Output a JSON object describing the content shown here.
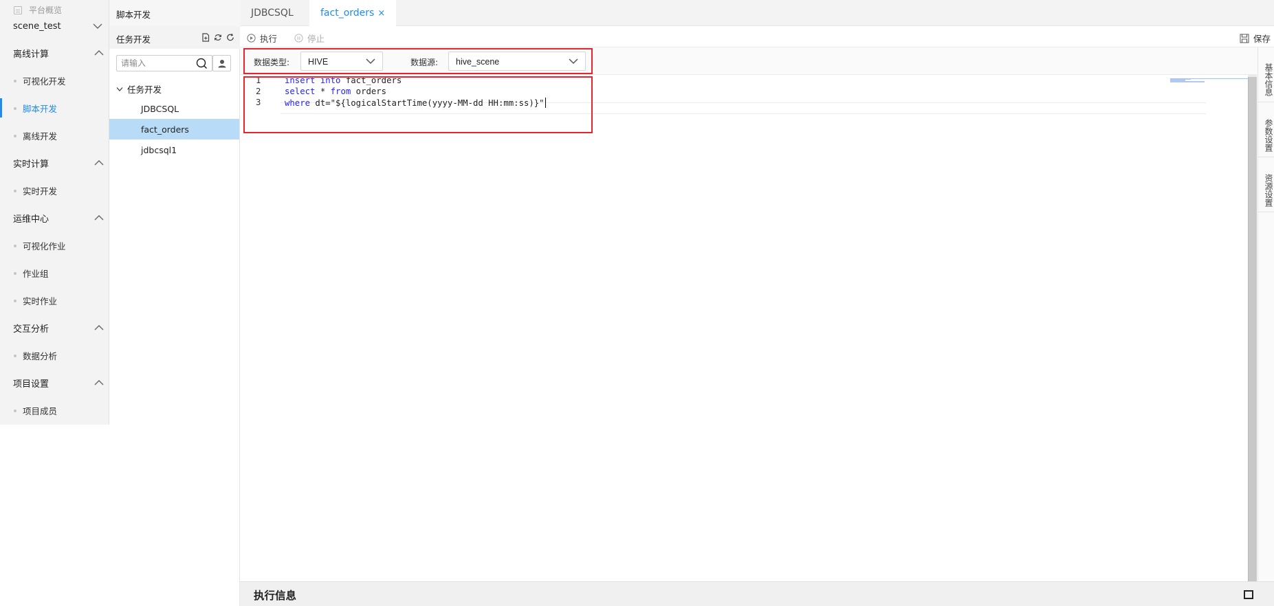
{
  "nav": {
    "overview": "平台概览",
    "project": "scene_test",
    "groups": [
      {
        "label": "离线计算",
        "items": [
          "可视化开发",
          "脚本开发",
          "离线开发"
        ]
      },
      {
        "label": "实时计算",
        "items": [
          "实时开发"
        ]
      },
      {
        "label": "运维中心",
        "items": [
          "可视化作业",
          "作业组",
          "实时作业"
        ]
      },
      {
        "label": "交互分析",
        "items": [
          "数据分析"
        ]
      },
      {
        "label": "项目设置",
        "items": [
          "项目成员"
        ]
      }
    ],
    "active_item": "脚本开发"
  },
  "tree": {
    "header": "脚本开发",
    "section": "任务开发",
    "search_placeholder": "请输入",
    "folder": "任务开发",
    "nodes": [
      "JDBCSQL",
      "fact_orders",
      "jdbcsql1"
    ],
    "selected": "fact_orders"
  },
  "tabs": [
    {
      "label": "JDBCSQL",
      "active": false
    },
    {
      "label": "fact_orders",
      "active": true,
      "close": "×"
    }
  ],
  "toolbar": {
    "run": "执行",
    "stop": "停止",
    "save": "保存"
  },
  "config": {
    "data_type_label": "数据类型:",
    "data_type_value": "HIVE",
    "datasource_label": "数据源:",
    "datasource_value": "hive_scene"
  },
  "editor": {
    "lines": [
      {
        "n": "1",
        "tokens": [
          {
            "t": "insert",
            "k": "kw"
          },
          {
            "t": " ",
            "k": ""
          },
          {
            "t": "into",
            "k": "kw"
          },
          {
            "t": " fact_orders",
            "k": ""
          }
        ]
      },
      {
        "n": "2",
        "tokens": [
          {
            "t": "select",
            "k": "kw"
          },
          {
            "t": " * ",
            "k": ""
          },
          {
            "t": "from",
            "k": "kw"
          },
          {
            "t": " orders",
            "k": ""
          }
        ]
      },
      {
        "n": "3",
        "tokens": [
          {
            "t": "where",
            "k": "kw"
          },
          {
            "t": " dt=\"${logicalStartTime(yyyy-MM-dd HH:mm:ss)}\"",
            "k": ""
          }
        ]
      }
    ]
  },
  "right_tabs": [
    "基本信息",
    "参数设置",
    "资源设置"
  ],
  "bottom": {
    "title": "执行信息"
  },
  "colors": {
    "accent": "#1f8ceb",
    "selected_row": "#b8dcf8",
    "highlight": "#e8232b",
    "keyword": "#1f1ffb"
  }
}
